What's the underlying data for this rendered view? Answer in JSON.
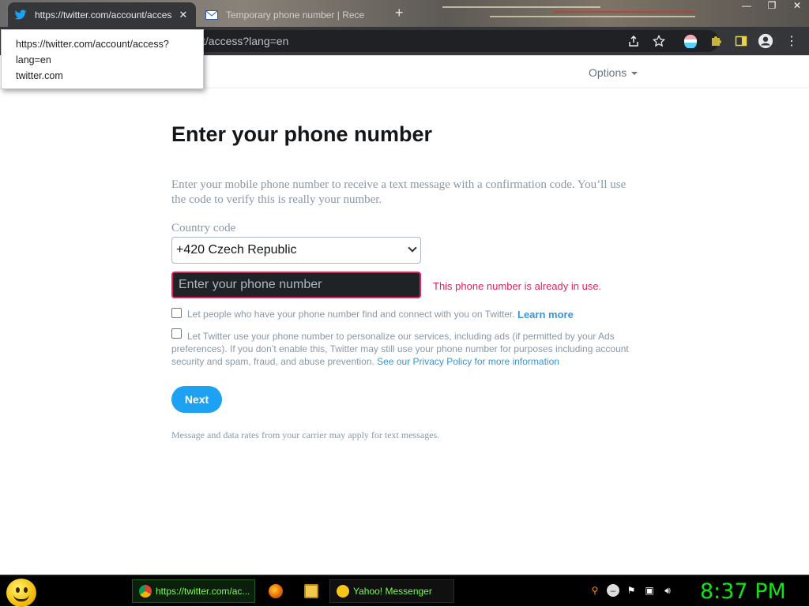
{
  "browser": {
    "tabs": [
      {
        "title": "https://twitter.com/account/access?lang=en",
        "active": true,
        "icon": "twitter-bird-icon"
      },
      {
        "title": "Temporary phone number | Rece",
        "active": false,
        "icon": "mail-envelope-icon"
      }
    ],
    "address_bar": {
      "visible_text": "t/access?lang=en"
    },
    "tooltip": {
      "line1": "https://twitter.com/account/access?",
      "line2": "lang=en",
      "line3": "twitter.com"
    },
    "colors": {
      "chrome_dark": "#35363a",
      "omnibox": "#202124"
    }
  },
  "page": {
    "header": {
      "options_label": "Options"
    },
    "heading": "Enter your phone number",
    "intro": "Enter your mobile phone number to receive a text message with a confirmation code. You’ll use the code to verify this is really your number.",
    "country_label": "Country code",
    "country_selected": "+420 Czech Republic",
    "phone_placeholder": "Enter your phone number",
    "error_message": "This phone number is already in use.",
    "checkbox1": {
      "text": "Let people who have your phone number find and connect with you on Twitter.",
      "link": "Learn more",
      "checked": false
    },
    "checkbox2": {
      "text": "Let Twitter use your phone number to personalize our services, including ads (if permitted by your Ads preferences). If you don’t enable this, Twitter may still use your phone number for purposes including account security and spam, fraud, and abuse prevention.",
      "link": "See our Privacy Policy for more information",
      "checked": false
    },
    "next_label": "Next",
    "footer_note": "Message and data rates from your carrier may apply for text messages.",
    "colors": {
      "accent": "#1da1f2",
      "error": "#e0245e",
      "link": "#3b94d9",
      "muted": "#8899a6"
    }
  },
  "taskbar": {
    "tasks": [
      {
        "label": "https://twitter.com/ac...",
        "icon": "chrome-icon"
      },
      {
        "label": "Yahoo! Messenger",
        "icon": "yahoo-smiley-icon"
      }
    ],
    "clock": "8:37 PM",
    "clock_color": "#18e018"
  }
}
